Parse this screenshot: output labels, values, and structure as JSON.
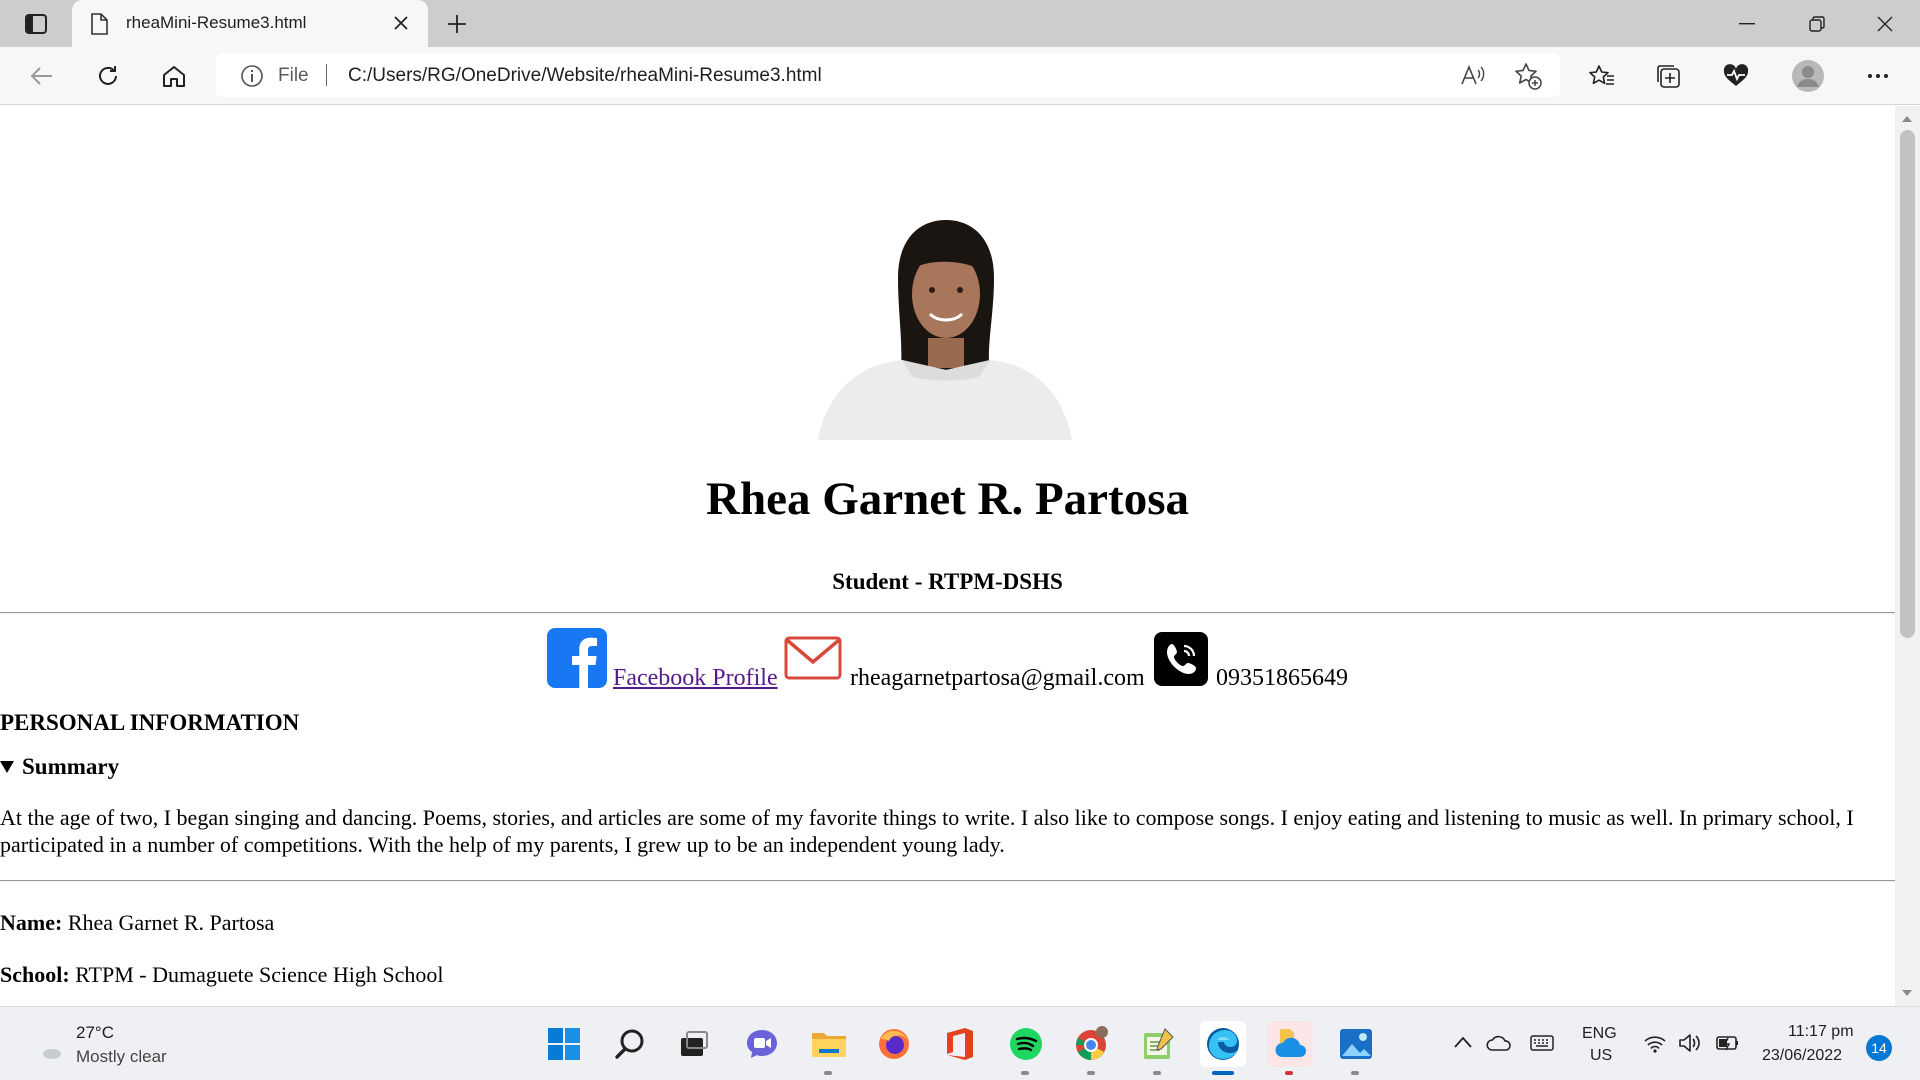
{
  "browser": {
    "tab_title": "rheaMini-Resume3.html",
    "address_scheme_label": "File",
    "url": "C:/Users/RG/OneDrive/Website/rheaMini-Resume3.html"
  },
  "page": {
    "name": "Rhea Garnet R. Partosa",
    "subtitle": "Student - RTPM-DSHS",
    "contacts": {
      "facebook_label": "Facebook Profile",
      "email": "rheagarnetpartosa@gmail.com",
      "phone": "09351865649"
    },
    "section_title": "PERSONAL INFORMATION",
    "summary_label": "Summary",
    "summary_text": "At the age of two, I began singing and dancing. Poems, stories, and articles are some of my favorite things to write. I also like to compose songs. I enjoy eating and listening to music as well. In primary school, I participated in a number of competitions. With the help of my parents, I grew up to be an independent young lady.",
    "fields": [
      {
        "label": "Name:",
        "value": "Rhea Garnet R. Partosa"
      },
      {
        "label": "School:",
        "value": "RTPM - Dumaguete Science High School"
      }
    ]
  },
  "taskbar": {
    "temperature": "27°C",
    "condition": "Mostly clear",
    "lang_line1": "ENG",
    "lang_line2": "US",
    "time": "11:17 pm",
    "date": "23/06/2022",
    "notification_count": "14"
  },
  "colors": {
    "accent": "#0067c0",
    "link_visited": "#551a8b",
    "facebook": "#1877f2"
  }
}
